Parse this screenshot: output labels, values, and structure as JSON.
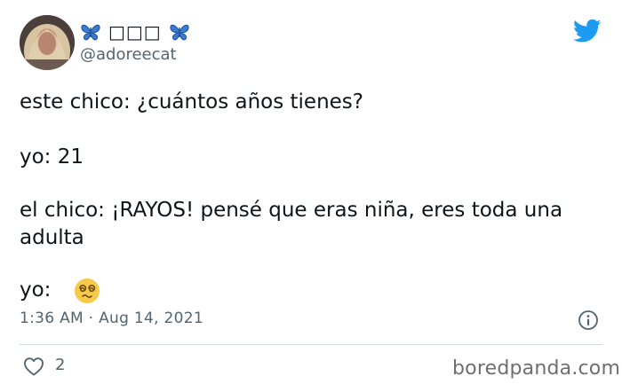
{
  "tweet": {
    "author": {
      "display_name": "□□□",
      "handle": "@adoreecat",
      "name_decoration_icon": "butterfly-icon",
      "avatar_icon": "avatar"
    },
    "brand": {
      "logo_icon": "twitter-bird-icon",
      "color": "#1d9bf0"
    },
    "text_lines": [
      "este chico: ¿cuántos años tienes?",
      "yo: 21",
      "el chico: ¡RAYOS! pensé que eras niña, eres toda una adulta",
      "yo:"
    ],
    "reaction_emoji": "dizzy-face-emoji",
    "timestamp": "1:36 AM · Aug 14, 2021",
    "info_icon": "info-icon",
    "likes": {
      "icon": "heart-icon",
      "count": "2"
    }
  },
  "watermark": "boredpanda.com",
  "colors": {
    "text": "#0f1419",
    "muted": "#536471",
    "divider": "#cfd9de",
    "butterfly": "#3a7bd5",
    "emoji": "#f7c948"
  }
}
